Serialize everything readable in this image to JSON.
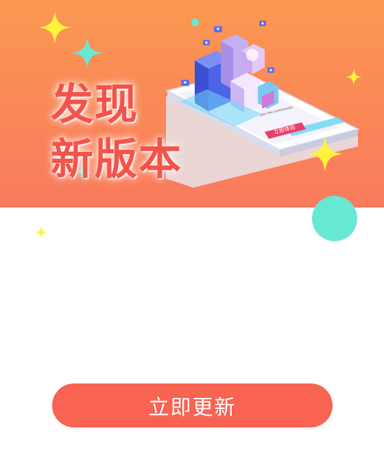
{
  "banner": {
    "headline_line1": "发现",
    "headline_line2": "新版本"
  },
  "illustration": {
    "screen_caption": "Join the community",
    "screen_button": "立即体验"
  },
  "update_button": {
    "label": "立即更新"
  },
  "colors": {
    "banner_top": "#fb9851",
    "banner_bottom": "#f97a5e",
    "headline": "#f4534a",
    "button": "#f86352",
    "teal_accent": "#66e8d4",
    "yellow_accent": "#ffee33"
  }
}
